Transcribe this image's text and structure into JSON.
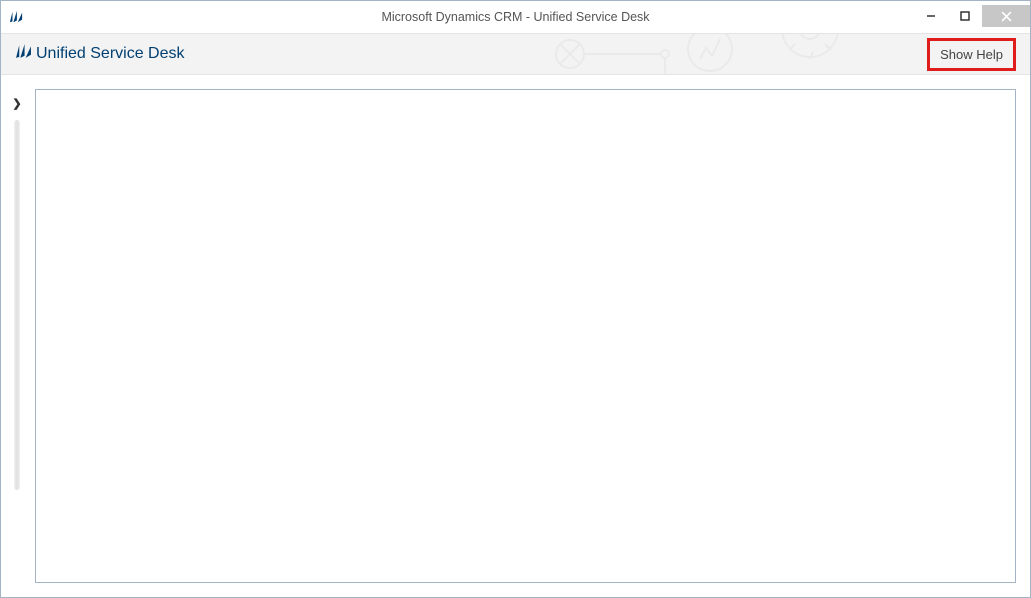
{
  "window": {
    "title": "Microsoft Dynamics CRM - Unified Service Desk"
  },
  "toolbar": {
    "app_name": "Unified Service Desk",
    "show_help_label": "Show Help"
  }
}
